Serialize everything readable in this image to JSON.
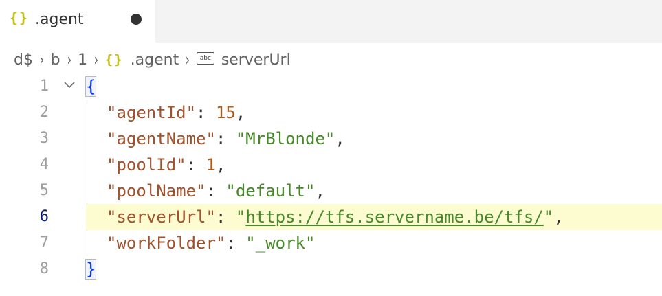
{
  "tab": {
    "icon": "json-braces-icon",
    "icon_glyph": "{}",
    "label": ".agent",
    "dirty": true
  },
  "breadcrumb": {
    "items": [
      "d$",
      "b",
      "1",
      ".agent",
      "serverUrl"
    ],
    "json_icon_glyph": "{}",
    "abc_icon_glyph": "abc",
    "separator": "›"
  },
  "editor": {
    "active_line": 6,
    "lines": [
      {
        "number": "1"
      },
      {
        "number": "2",
        "key": "\"agentId\"",
        "value": "15",
        "trail": ","
      },
      {
        "number": "3",
        "key": "\"agentName\"",
        "value": "\"MrBlonde\"",
        "trail": ","
      },
      {
        "number": "4",
        "key": "\"poolId\"",
        "value": "1",
        "trail": ","
      },
      {
        "number": "5",
        "key": "\"poolName\"",
        "value": "\"default\"",
        "trail": ","
      },
      {
        "number": "6",
        "key": "\"serverUrl\"",
        "value_open": "\"",
        "value_url": "https://tfs.servername.be/tfs/",
        "value_close": "\"",
        "trail": ","
      },
      {
        "number": "7",
        "key": "\"workFolder\"",
        "value": "\"_work\"",
        "trail": ""
      },
      {
        "number": "8"
      }
    ],
    "open_brace": "{",
    "close_brace": "}",
    "colon": ": "
  },
  "colors": {
    "key": "#a0522d",
    "number": "#a85d1f",
    "string": "#478829",
    "brace": "#0431fa",
    "highlight": "#fcfcd0",
    "json_icon": "#c6c118"
  }
}
